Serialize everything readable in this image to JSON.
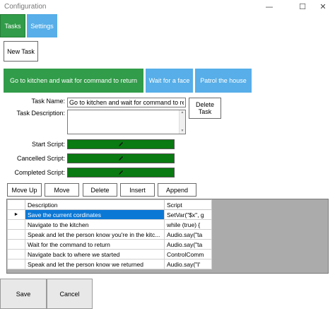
{
  "window": {
    "title": "Configuration"
  },
  "nav_tabs": {
    "tasks": "Tasks",
    "settings": "Settings"
  },
  "buttons": {
    "new_task": "New Task",
    "delete_task": "Delete Task"
  },
  "task_tabs": [
    {
      "label": "Go to kitchen and wait for command to return",
      "color": "#319c49"
    },
    {
      "label": "Wait for a face",
      "color": "#57aee8"
    },
    {
      "label": "Patrol the house",
      "color": "#57aee8"
    }
  ],
  "form": {
    "task_name_label": "Task Name:",
    "task_name_value": "Go to kitchen and wait for command to return",
    "task_description_label": "Task Description:",
    "task_description_value": "",
    "start_script_label": "Start Script:",
    "cancelled_script_label": "Cancelled Script:",
    "completed_script_label": "Completed Script:",
    "script_bar_color": "#0a7a12",
    "script_icon": "pencil-icon"
  },
  "toolbar": {
    "move_up": "Move Up",
    "move": "Move",
    "delete": "Delete",
    "insert": "Insert",
    "append": "Append"
  },
  "grid": {
    "columns": [
      "Description",
      "Script"
    ],
    "rows": [
      {
        "description": "Save the current cordinates",
        "script": "SetVar(\"$x\", g",
        "selected": true
      },
      {
        "description": "Navigate to the kitchen",
        "script": "while (true) {",
        "selected": false
      },
      {
        "description": "Speak and let the person know you're in the kitc...",
        "script": "Audio.say(\"ta",
        "selected": false
      },
      {
        "description": "Wait for the command to return",
        "script": "Audio.say(\"ta",
        "selected": false
      },
      {
        "description": "Navigate back to where we started",
        "script": "ControlComm",
        "selected": false
      },
      {
        "description": "Speak and let the person know we returned",
        "script": "Audio.say(\"I'",
        "selected": false
      }
    ],
    "row_indicator": "►"
  },
  "footer": {
    "save": "Save",
    "cancel": "Cancel"
  }
}
